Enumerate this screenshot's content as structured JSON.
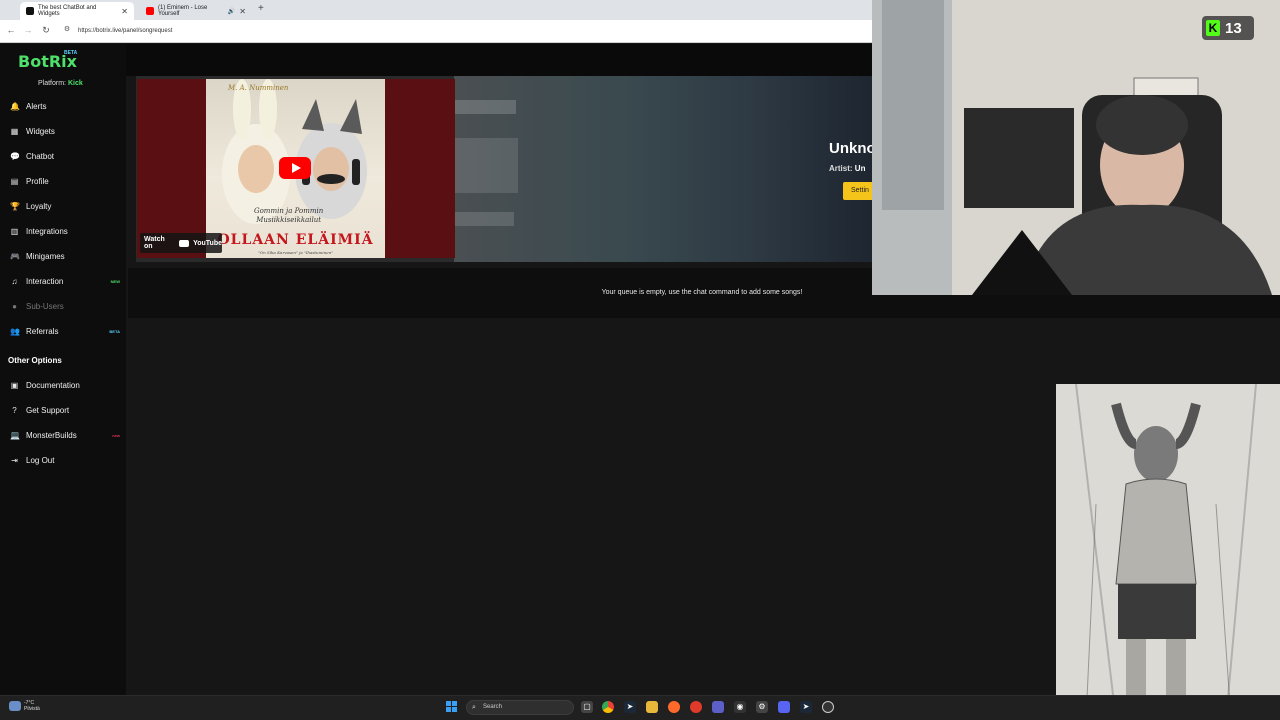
{
  "browser": {
    "tabs": [
      {
        "title": "The best ChatBot and Widgets",
        "active": true
      },
      {
        "title": "(1) Eminem - Lose Yourself",
        "active": false
      }
    ],
    "url": "https://botrix.live/panel/songrequest"
  },
  "app": {
    "logo": "BotRix",
    "beta_badge": "BETA",
    "platform_label": "Platform:",
    "platform_value": "Kick"
  },
  "sidebar": {
    "items": [
      {
        "label": "Alerts",
        "icon": "bell-icon",
        "glyph": "🔔"
      },
      {
        "label": "Widgets",
        "icon": "grid-icon",
        "glyph": "▦"
      },
      {
        "label": "Chatbot",
        "icon": "chat-icon",
        "glyph": "💬"
      },
      {
        "label": "Profile",
        "icon": "profile-card-icon",
        "glyph": "▤"
      },
      {
        "label": "Loyalty",
        "icon": "trophy-icon",
        "glyph": "🏆"
      },
      {
        "label": "Integrations",
        "icon": "layers-icon",
        "glyph": "▥"
      },
      {
        "label": "Minigames",
        "icon": "gamepad-icon",
        "glyph": "🎮"
      },
      {
        "label": "Interaction",
        "icon": "music-note-icon",
        "glyph": "♫",
        "badge": "NEW"
      },
      {
        "label": "Sub-Users",
        "icon": "person-icon",
        "glyph": "●",
        "disabled": true
      },
      {
        "label": "Referrals",
        "icon": "users-icon",
        "glyph": "👥",
        "badge": "BETA"
      }
    ],
    "other_heading": "Other Options",
    "other_items": [
      {
        "label": "Documentation",
        "icon": "book-icon",
        "glyph": "▣"
      },
      {
        "label": "Get Support",
        "icon": "question-icon",
        "glyph": "?"
      },
      {
        "label": "MonsterBuilds",
        "icon": "laptop-icon",
        "glyph": "💻",
        "badge": "new"
      },
      {
        "label": "Log Out",
        "icon": "logout-icon",
        "glyph": "⇥"
      }
    ]
  },
  "now_playing": {
    "title": "Unkno",
    "artist_label": "Artist:",
    "artist_value": "Un",
    "settings_label": "Settin",
    "watch_on": "Watch on",
    "youtube": "YouTube",
    "album_top": "M. A. Numminen",
    "album_sub_1": "Gommin ja Pommin",
    "album_sub_2": "Musiikkiseikkailut",
    "album_big": "OLLAAN ELÄIMIÄ",
    "album_foot": "\"On Sika Karvasen\" ja \"Ihastuminen\""
  },
  "queue": {
    "empty_message": "Your queue is empty, use the chat command to add some songs!"
  },
  "stream_overlay": {
    "platform_icon": "kick-icon",
    "viewer_count": "13"
  },
  "taskbar": {
    "weather_temp": "-7°C",
    "weather_desc": "Pilvistä",
    "search_placeholder": "Search"
  },
  "colors": {
    "accent_green": "#4ee06a",
    "kick_green": "#53fc18",
    "settings_yellow": "#f4c41a"
  }
}
